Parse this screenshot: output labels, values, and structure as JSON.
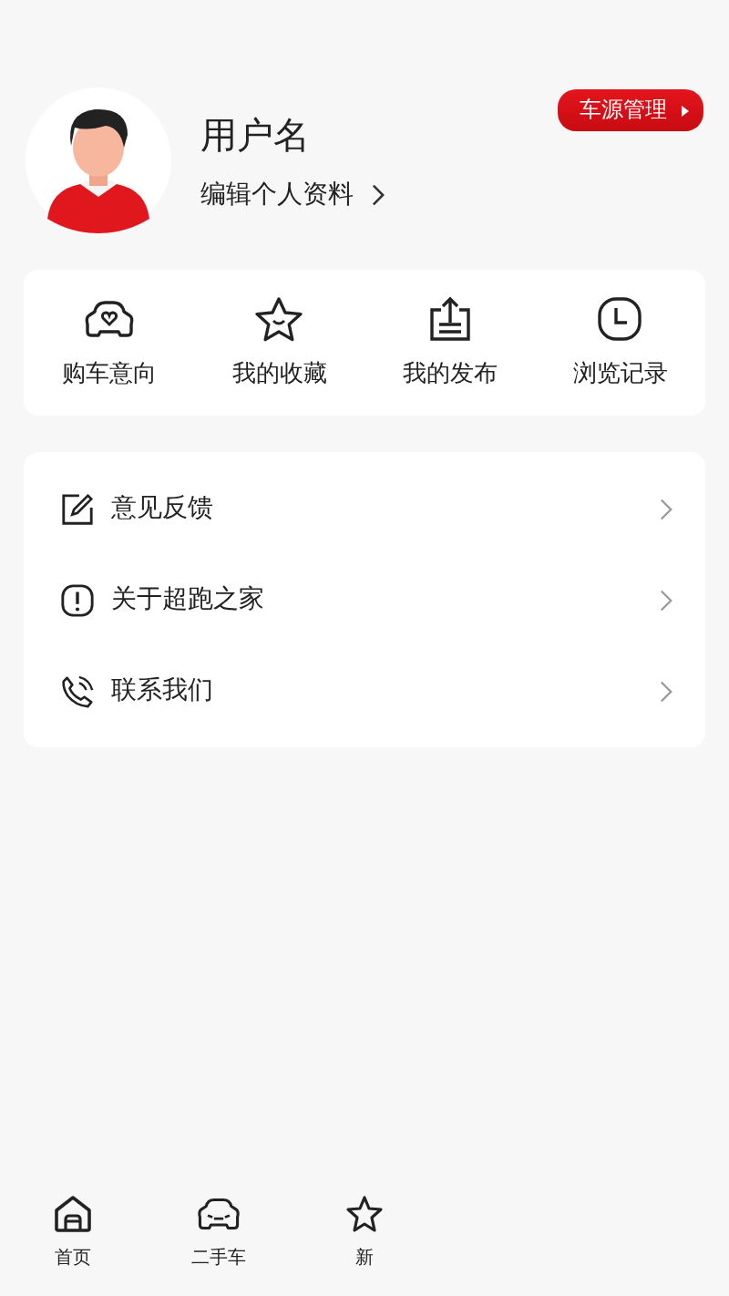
{
  "profile": {
    "username": "用户名",
    "edit_link": "编辑个人资料",
    "badge": "车源管理"
  },
  "shortcuts": [
    {
      "kind": "car-heart",
      "label": "购车意向"
    },
    {
      "kind": "star",
      "label": "我的收藏"
    },
    {
      "kind": "upload",
      "label": "我的发布"
    },
    {
      "kind": "clock",
      "label": "浏览记录"
    }
  ],
  "menu": [
    {
      "kind": "edit",
      "label": "意见反馈"
    },
    {
      "kind": "alert",
      "label": "关于超跑之家"
    },
    {
      "kind": "phone",
      "label": "联系我们"
    }
  ],
  "tab_bar": [
    {
      "kind": "home",
      "label": "首页"
    },
    {
      "kind": "car",
      "label": "二手车"
    },
    {
      "kind": "news",
      "label": "新"
    }
  ]
}
